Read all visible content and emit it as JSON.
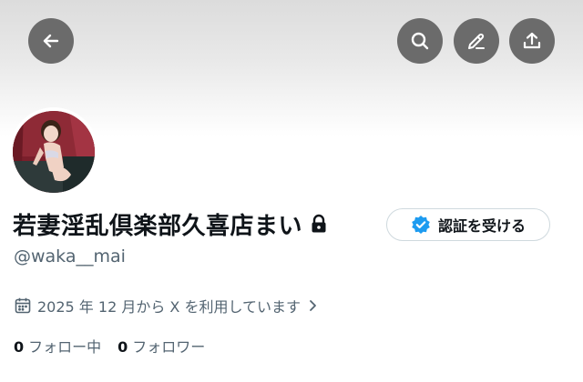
{
  "header": {
    "back_icon": "arrow-left-icon",
    "search_icon": "search-icon",
    "edit_icon": "pencil-icon",
    "share_icon": "share-upload-icon",
    "button_bg": "#6b6b6b"
  },
  "profile": {
    "display_name": "若妻淫乱倶楽部久喜店まい",
    "handle": "@waka__mai",
    "protected_icon": "lock-icon",
    "verify_button": {
      "label": "認証を受ける",
      "icon": "verified-badge-icon",
      "badge_color": "#1d9bf0"
    },
    "joined_text": "2025 年 12 月から X を利用しています",
    "following": {
      "count": "0",
      "label": "フォロー中"
    },
    "followers": {
      "count": "0",
      "label": "フォロワー"
    }
  },
  "colors": {
    "text_primary": "#0f1419",
    "text_secondary": "#536471"
  }
}
